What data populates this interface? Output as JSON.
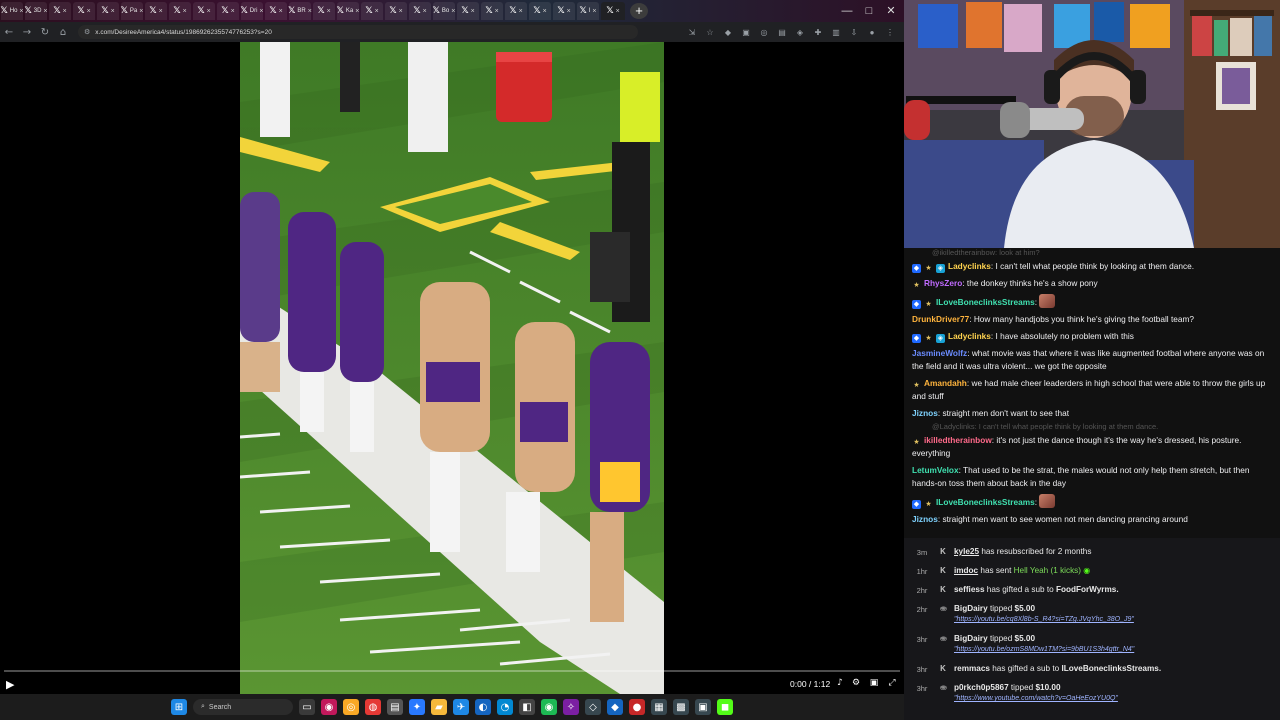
{
  "browser": {
    "tabs": [
      {
        "label": "Ho"
      },
      {
        "label": "3D"
      },
      {
        "label": ""
      },
      {
        "label": ""
      },
      {
        "label": ""
      },
      {
        "label": "Pa"
      },
      {
        "label": ""
      },
      {
        "label": ""
      },
      {
        "label": ""
      },
      {
        "label": ""
      },
      {
        "label": "Dri"
      },
      {
        "label": ""
      },
      {
        "label": "BR"
      },
      {
        "label": ""
      },
      {
        "label": "Ka"
      },
      {
        "label": ""
      },
      {
        "label": ""
      },
      {
        "label": ""
      },
      {
        "label": "Bo"
      },
      {
        "label": ""
      },
      {
        "label": ""
      },
      {
        "label": ""
      },
      {
        "label": ""
      },
      {
        "label": ""
      },
      {
        "label": "I"
      },
      {
        "label": ""
      }
    ],
    "url": "x.com/DesireeAmerica4/status/1986926235574776253?s=20"
  },
  "video": {
    "time": "0:00 / 1:12",
    "progress_fraction": 0.0
  },
  "taskbar": {
    "search_label": "Search"
  },
  "chat": {
    "faded_top": "@ikilledtherainbow: look at him?",
    "messages": [
      {
        "user": "Ladyclinks",
        "color": "#ffd34f",
        "badges": [
          "prime",
          "sub",
          "glitch"
        ],
        "text": "I can't tell what people think by looking at them dance."
      },
      {
        "user": "RhysZero",
        "color": "#c06bff",
        "badges": [
          "sub"
        ],
        "text": "the donkey thinks he's a show pony"
      },
      {
        "user": "ILoveBoneclinksStreams",
        "color": "#40e0b0",
        "badges": [
          "prime",
          "sub"
        ],
        "text": "",
        "emote": true
      },
      {
        "user": "DrunkDriver77",
        "color": "#ffb43d",
        "badges": [],
        "text": "How many handjobs you think he's giving the football team?"
      },
      {
        "user": "Ladyclinks",
        "color": "#ffd34f",
        "badges": [
          "prime",
          "sub",
          "glitch"
        ],
        "text": "I have absolutely no problem with this"
      },
      {
        "user": "JasmineWolfz",
        "color": "#6b8cff",
        "badges": [],
        "text": "what movie was that where it was like augmented footbal where anyone was on the field and it was ultra violent... we got the opposite"
      },
      {
        "user": "Amandahh",
        "color": "#ffb43d",
        "badges": [
          "sub"
        ],
        "text": "we had male cheer leaderders in high school that were able to throw the girls up and stuff"
      },
      {
        "user": "Jiznos",
        "color": "#7fd3ff",
        "badges": [],
        "text": "straight men don't want to see that"
      },
      {
        "user": "ikilledtherainbow",
        "color": "#ff6a8a",
        "badges": [
          "sub"
        ],
        "text": "it's not just the dance though it's the way he's dressed, his posture. everything",
        "reply": "@Ladyclinks: I can't tell what people think by looking at them dance."
      },
      {
        "user": "LetumVelox",
        "color": "#40e0b0",
        "badges": [],
        "text": "That used to be the strat, the males would not only help them stretch, but then hands-on toss them about back in the day"
      },
      {
        "user": "ILoveBoneclinksStreams",
        "color": "#40e0b0",
        "badges": [
          "prime",
          "sub"
        ],
        "text": "",
        "emote": true
      },
      {
        "user": "Jiznos",
        "color": "#7fd3ff",
        "badges": [],
        "text": "straight men want to see women not men dancing prancing around"
      }
    ]
  },
  "events": [
    {
      "ago": "3m",
      "icon": "kick",
      "name": "kyle25",
      "text": " has resubscribed for 2 months",
      "underline": true
    },
    {
      "ago": "1hr",
      "icon": "kick",
      "name": "imdoc",
      "text": " has sent ",
      "extra": "Hell Yeah (1 kicks)",
      "underline": true
    },
    {
      "ago": "2hr",
      "icon": "kick",
      "name": "seffiess",
      "text": " has gifted a sub to ",
      "extra": "FoodForWyrms."
    },
    {
      "ago": "2hr",
      "icon": "tip",
      "name": "BigDairy",
      "text": " tipped ",
      "extra": "$5.00",
      "link": "\"https://youtu.be/cq8Xl8b-S_R4?si=TZg.JVqYhc_38O_J9\""
    },
    {
      "ago": "3hr",
      "icon": "tip",
      "name": "BigDairy",
      "text": " tipped ",
      "extra": "$5.00",
      "link": "\"https://youtu.be/ozmS8MDw1TM?si=9bBU1S3h4gttr_N4\""
    },
    {
      "ago": "3hr",
      "icon": "kick",
      "name": "remmacs",
      "text": " has gifted a sub to ",
      "extra": "ILoveBoneclinksStreams."
    },
    {
      "ago": "3hr",
      "icon": "tip",
      "name": "p0rkch0p5867",
      "text": " tipped ",
      "extra": "$10.00",
      "link": "\"https://www.youtube.com/watch?v=OaHeEozYU0Q\""
    }
  ],
  "colors": {
    "accent": "#1d9bf0",
    "vikings_purple": "#4f2683",
    "vikings_gold": "#ffc62f",
    "turf": "#4f8a2c"
  }
}
